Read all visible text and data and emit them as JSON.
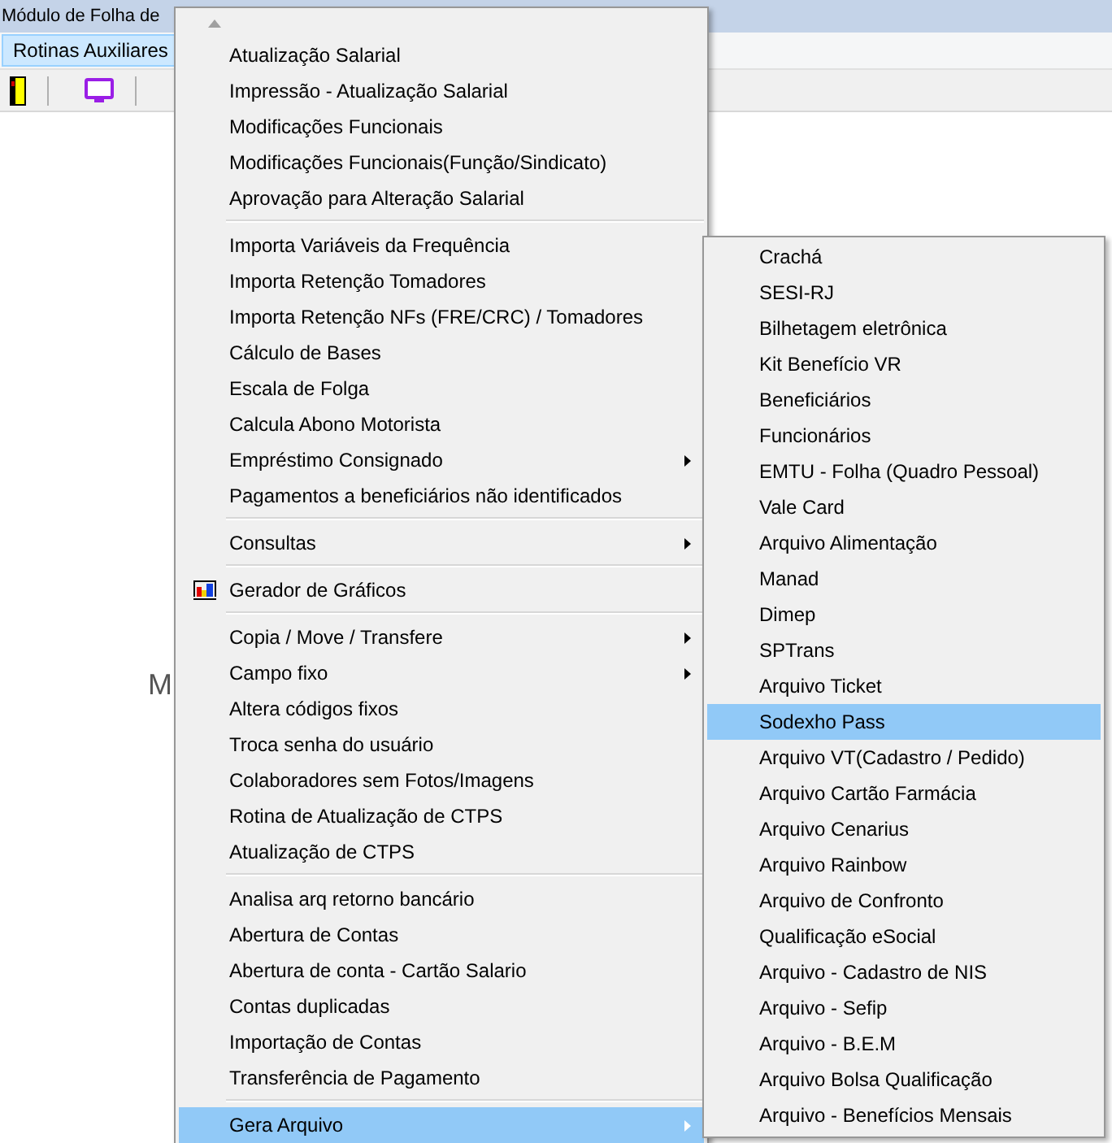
{
  "window": {
    "title": "Módulo de Folha de"
  },
  "menubar": [
    {
      "label": "Rotinas Auxiliares",
      "selected": true
    }
  ],
  "background_text": "M",
  "menu": {
    "items": [
      {
        "kind": "item",
        "label": "Atualização Salarial",
        "submenu": false,
        "selected": false
      },
      {
        "kind": "item",
        "label": "Impressão - Atualização Salarial",
        "submenu": false,
        "selected": false
      },
      {
        "kind": "item",
        "label": "Modificações Funcionais",
        "submenu": false,
        "selected": false
      },
      {
        "kind": "item",
        "label": "Modificações Funcionais(Função/Sindicato)",
        "submenu": false,
        "selected": false
      },
      {
        "kind": "item",
        "label": "Aprovação para Alteração Salarial",
        "submenu": false,
        "selected": false
      },
      {
        "kind": "separator"
      },
      {
        "kind": "item",
        "label": "Importa Variáveis da Frequência",
        "submenu": false,
        "selected": false
      },
      {
        "kind": "item",
        "label": "Importa Retenção Tomadores",
        "submenu": false,
        "selected": false
      },
      {
        "kind": "item",
        "label": "Importa Retenção NFs (FRE/CRC) / Tomadores",
        "submenu": false,
        "selected": false
      },
      {
        "kind": "item",
        "label": "Cálculo de Bases",
        "submenu": false,
        "selected": false
      },
      {
        "kind": "item",
        "label": "Escala de Folga",
        "submenu": false,
        "selected": false
      },
      {
        "kind": "item",
        "label": "Calcula Abono Motorista",
        "submenu": false,
        "selected": false
      },
      {
        "kind": "item",
        "label": "Empréstimo Consignado",
        "submenu": true,
        "selected": false
      },
      {
        "kind": "item",
        "label": "Pagamentos a beneficiários não identificados",
        "submenu": false,
        "selected": false
      },
      {
        "kind": "separator"
      },
      {
        "kind": "item",
        "label": "Consultas",
        "submenu": true,
        "selected": false
      },
      {
        "kind": "separator"
      },
      {
        "kind": "icon_item",
        "label": "Gerador de Gráficos",
        "submenu": false,
        "selected": false
      },
      {
        "kind": "separator"
      },
      {
        "kind": "item",
        "label": "Copia / Move / Transfere",
        "submenu": true,
        "selected": false
      },
      {
        "kind": "item",
        "label": "Campo fixo",
        "submenu": true,
        "selected": false
      },
      {
        "kind": "item",
        "label": "Altera códigos fixos",
        "submenu": false,
        "selected": false
      },
      {
        "kind": "item",
        "label": "Troca senha do usuário",
        "submenu": false,
        "selected": false
      },
      {
        "kind": "item",
        "label": "Colaboradores sem Fotos/Imagens",
        "submenu": false,
        "selected": false
      },
      {
        "kind": "item",
        "label": "Rotina de Atualização de CTPS",
        "submenu": false,
        "selected": false
      },
      {
        "kind": "item",
        "label": "Atualização de CTPS",
        "submenu": false,
        "selected": false
      },
      {
        "kind": "separator"
      },
      {
        "kind": "item",
        "label": "Analisa arq retorno bancário",
        "submenu": false,
        "selected": false
      },
      {
        "kind": "item",
        "label": "Abertura de Contas",
        "submenu": false,
        "selected": false
      },
      {
        "kind": "item",
        "label": "Abertura de conta - Cartão Salario",
        "submenu": false,
        "selected": false
      },
      {
        "kind": "item",
        "label": "Contas duplicadas",
        "submenu": false,
        "selected": false
      },
      {
        "kind": "item",
        "label": "Importação de Contas",
        "submenu": false,
        "selected": false
      },
      {
        "kind": "item",
        "label": "Transferência de Pagamento",
        "submenu": false,
        "selected": false
      },
      {
        "kind": "separator"
      },
      {
        "kind": "item",
        "label": "Gera Arquivo",
        "submenu": true,
        "selected": true
      }
    ]
  },
  "submenu": {
    "items": [
      {
        "label": "Crachá",
        "selected": false
      },
      {
        "label": "SESI-RJ",
        "selected": false
      },
      {
        "label": "Bilhetagem eletrônica",
        "selected": false
      },
      {
        "label": "Kit Benefício VR",
        "selected": false
      },
      {
        "label": "Beneficiários",
        "selected": false
      },
      {
        "label": "Funcionários",
        "selected": false
      },
      {
        "label": "EMTU - Folha (Quadro Pessoal)",
        "selected": false
      },
      {
        "label": "Vale Card",
        "selected": false
      },
      {
        "label": "Arquivo Alimentação",
        "selected": false
      },
      {
        "label": "Manad",
        "selected": false
      },
      {
        "label": "Dimep",
        "selected": false
      },
      {
        "label": "SPTrans",
        "selected": false
      },
      {
        "label": "Arquivo Ticket",
        "selected": false
      },
      {
        "label": "Sodexho Pass",
        "selected": true
      },
      {
        "label": "Arquivo VT(Cadastro / Pedido)",
        "selected": false
      },
      {
        "label": "Arquivo Cartão Farmácia",
        "selected": false
      },
      {
        "label": "Arquivo Cenarius",
        "selected": false
      },
      {
        "label": "Arquivo Rainbow",
        "selected": false
      },
      {
        "label": "Arquivo de Confronto",
        "selected": false
      },
      {
        "label": "Qualificação eSocial",
        "selected": false
      },
      {
        "label": "Arquivo - Cadastro de NIS",
        "selected": false
      },
      {
        "label": "Arquivo - Sefip",
        "selected": false
      },
      {
        "label": "Arquivo - B.E.M",
        "selected": false
      },
      {
        "label": "Arquivo Bolsa Qualificação",
        "selected": false
      },
      {
        "label": "Arquivo - Benefícios Mensais",
        "selected": false
      }
    ]
  }
}
